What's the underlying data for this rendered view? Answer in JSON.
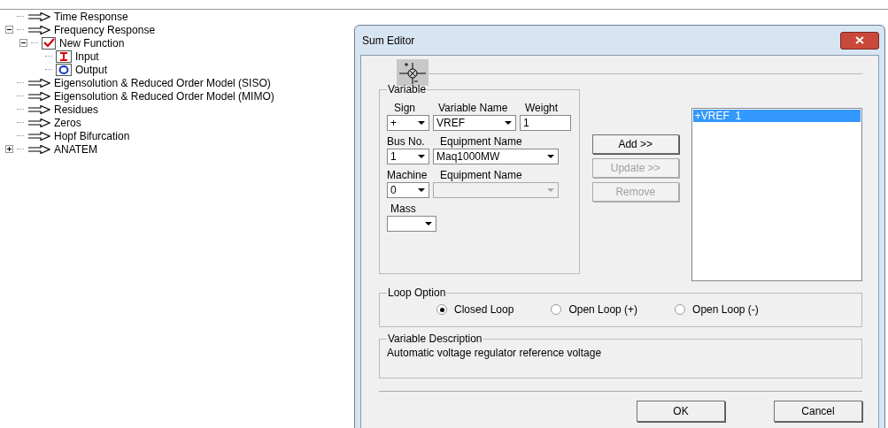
{
  "tree": [
    {
      "label": "Time Response",
      "kind": "arrow"
    },
    {
      "label": "Frequency Response",
      "kind": "arrow",
      "expanded": true,
      "children": [
        {
          "label": "New Function",
          "kind": "check",
          "expanded": true,
          "children": [
            {
              "label": "Input",
              "kind": "input"
            },
            {
              "label": "Output",
              "kind": "output"
            }
          ]
        }
      ]
    },
    {
      "label": "Eigensolution & Reduced Order Model (SISO)",
      "kind": "arrow"
    },
    {
      "label": "Eigensolution & Reduced Order Model (MIMO)",
      "kind": "arrow"
    },
    {
      "label": "Residues",
      "kind": "arrow"
    },
    {
      "label": "Zeros",
      "kind": "arrow"
    },
    {
      "label": "Hopf Bifurcation",
      "kind": "arrow"
    },
    {
      "label": "ANATEM",
      "kind": "arrow",
      "expanded": false
    }
  ],
  "dialog": {
    "title": "Sum Editor",
    "variable_group": {
      "title": "Variable",
      "sign": {
        "label": "Sign",
        "value": "+"
      },
      "variable_name": {
        "label": "Variable Name",
        "value": "VREF"
      },
      "weight": {
        "label": "Weight",
        "value": "1"
      },
      "bus_no": {
        "label": "Bus No.",
        "value": "1"
      },
      "equipment_name": {
        "label": "Equipment Name",
        "value": "Maq1000MW"
      },
      "machine": {
        "label": "Machine",
        "value": "0"
      },
      "equipment_name_2": {
        "label": "Equipment Name",
        "disabled": true
      },
      "mass": {
        "label": "Mass"
      }
    },
    "buttons": [
      {
        "label": "Add >>",
        "disabled": false
      },
      {
        "label": "Update >>",
        "disabled": true
      },
      {
        "label": "Remove",
        "disabled": true
      }
    ],
    "list": [
      {
        "label": "+VREF  1",
        "selected": true
      }
    ],
    "loop_option": {
      "title": "Loop Option",
      "options": [
        {
          "label": "Closed Loop",
          "selected": true
        },
        {
          "label": "Open Loop (+)",
          "selected": false
        },
        {
          "label": "Open Loop (-)",
          "selected": false
        }
      ]
    },
    "description": {
      "title": "Variable Description",
      "text": "Automatic voltage regulator reference voltage"
    },
    "ok": "OK",
    "cancel": "Cancel"
  }
}
